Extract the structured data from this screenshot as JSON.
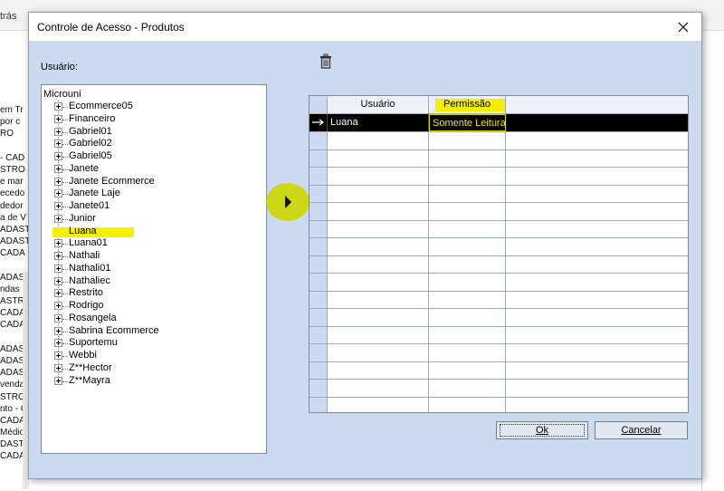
{
  "background": {
    "menu_fragment": "trás",
    "list_fragments": [
      "em Tr",
      "por c",
      "RO",
      "",
      "- CAD",
      "STRO",
      "e mar",
      "ecedo",
      "dedor",
      "a de V",
      "ADAST",
      "ADAST",
      "CADA",
      "",
      "ADAST",
      "ndas",
      "ASTR",
      "CADA",
      "CADA",
      "",
      "ADAST",
      "ADAST",
      "ADAST",
      "venda",
      "STRO",
      "nto - C",
      "CADA",
      "Médio",
      "DASTR",
      "CADA"
    ]
  },
  "dialog": {
    "title": "Controle de Acesso - Produtos",
    "usuario_label": "Usuário:",
    "tree": {
      "root": "Microuni",
      "items": [
        "Ecommerce05",
        "Financeiro",
        "Gabriel01",
        "Gabriel02",
        "Gabriel05",
        "Janete",
        "Janete Ecommerce",
        "Janete Laje",
        "Janete01",
        "Junior",
        "Luana",
        "Luana01",
        "Nathali",
        "Nathali01",
        "Nathaliec",
        "Restrito",
        "Rodrigo",
        "Rosangela",
        "Sabrina Ecommerce",
        "Suportemu",
        "Webbi",
        "Z**Hector",
        "Z**Mayra"
      ]
    },
    "grid": {
      "headers": {
        "usuario": "Usuário",
        "permissao": "Permissão"
      },
      "rows": [
        {
          "usuario": "Luana",
          "permissao": "Somente Leitura"
        }
      ]
    },
    "buttons": {
      "ok": "Ok",
      "cancel": "Cancelar"
    }
  },
  "colors": {
    "highlight": "#f2f000",
    "dialog_bg": "#cbdaef"
  },
  "icons": [
    "close-icon",
    "trash-icon",
    "expander-plus-icon",
    "move-right-arrow-icon",
    "row-pointer-arrow-icon"
  ]
}
